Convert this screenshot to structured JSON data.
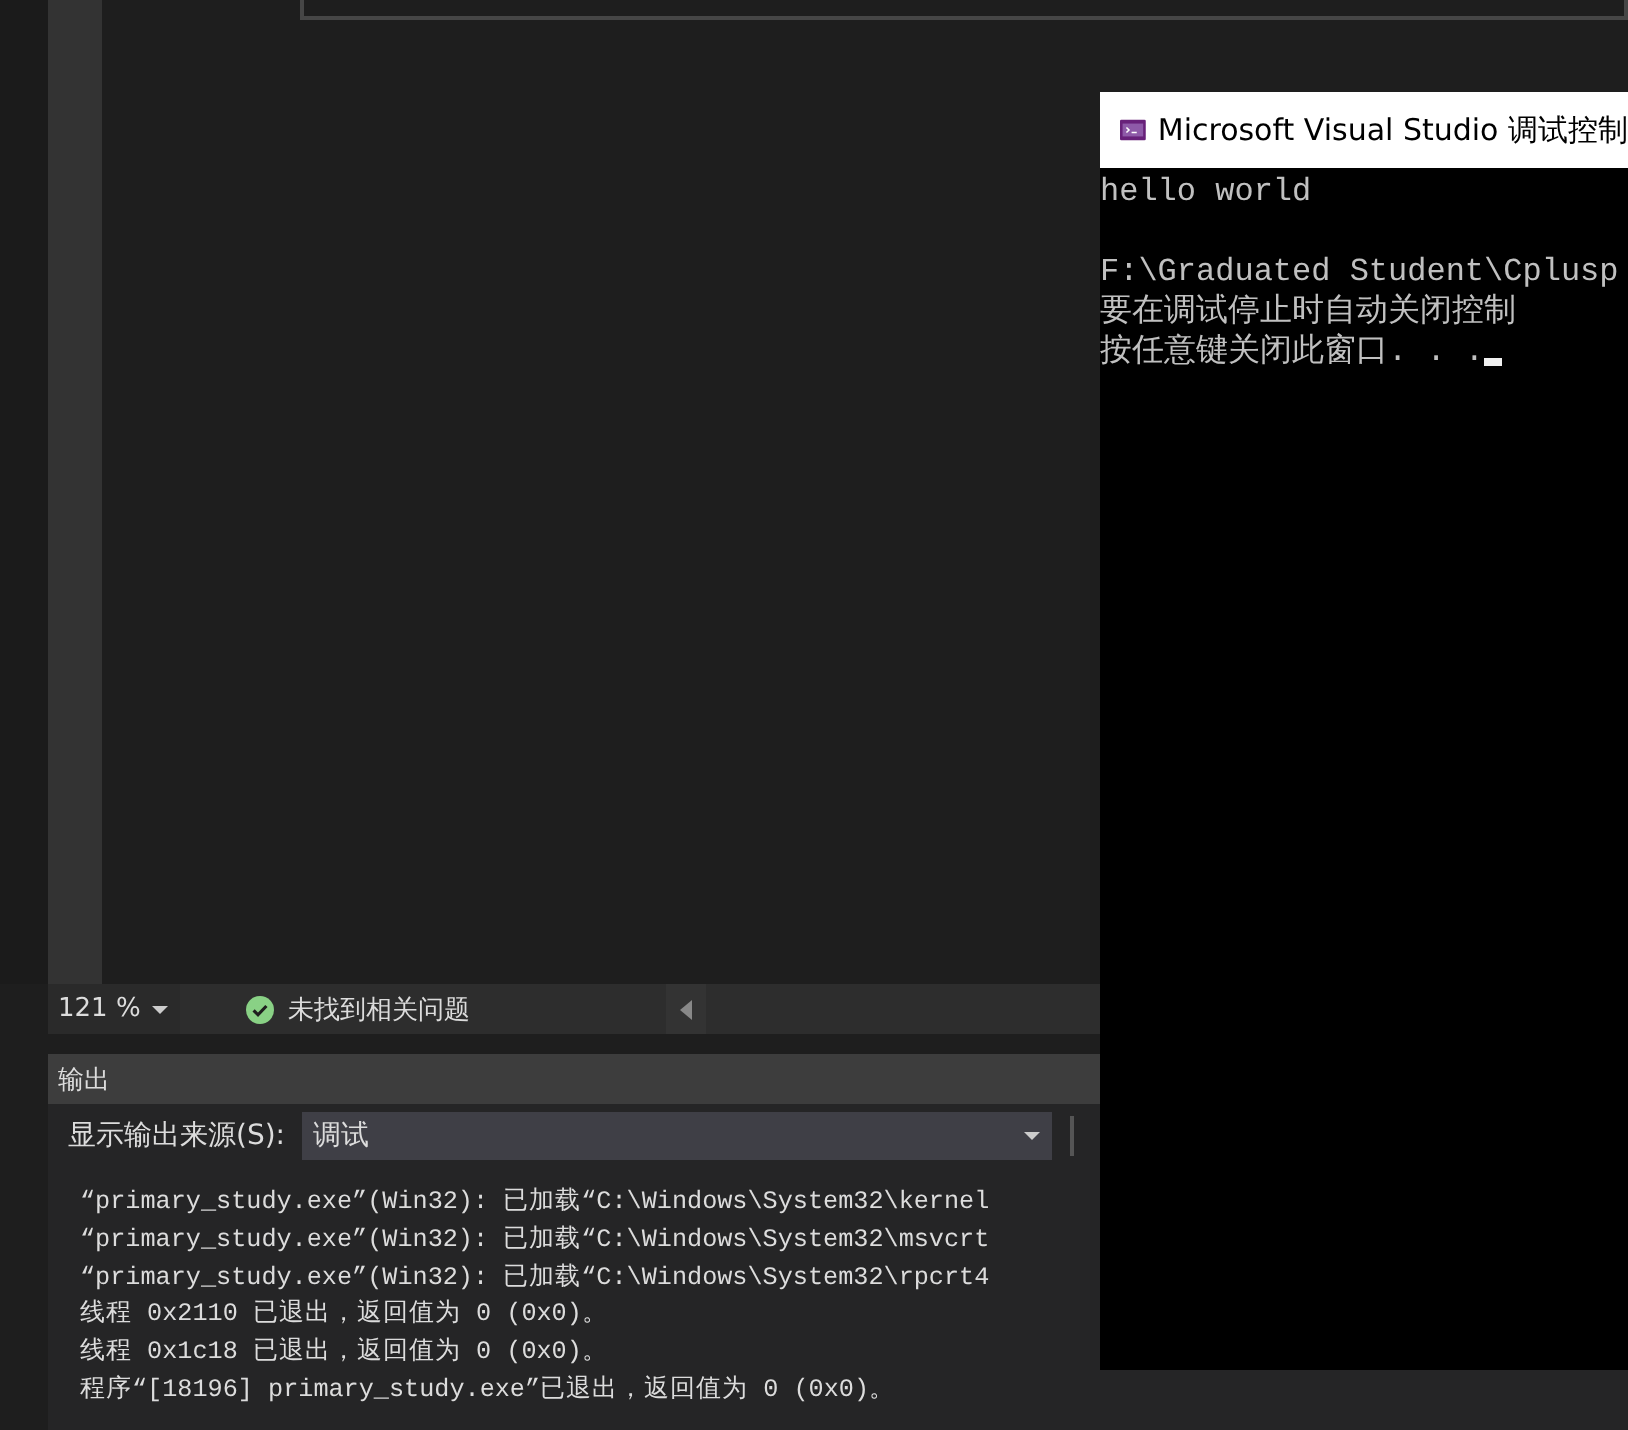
{
  "status_bar": {
    "zoom": "121 %",
    "issues": "未找到相关问题"
  },
  "output_panel": {
    "title": "输出",
    "source_label": "显示输出来源(S):",
    "source_value": "调试",
    "lines": [
      "“primary_study.exe”(Win32): 已加载“C:\\Windows\\System32\\kernel",
      "“primary_study.exe”(Win32): 已加载“C:\\Windows\\System32\\msvcrt",
      "“primary_study.exe”(Win32): 已加载“C:\\Windows\\System32\\rpcrt4",
      "线程 0x2110 已退出，返回值为 0 (0x0)。",
      "线程 0x1c18 已退出，返回值为 0 (0x0)。",
      "程序“[18196] primary_study.exe”已退出，返回值为 0 (0x0)。"
    ]
  },
  "console": {
    "title": "Microsoft Visual Studio 调试控制",
    "program_output": [
      "hello world"
    ],
    "messages": [
      "F:\\Graduated Student\\Cplusp",
      "要在调试停止时自动关闭控制",
      "按任意键关闭此窗口. . ."
    ]
  }
}
